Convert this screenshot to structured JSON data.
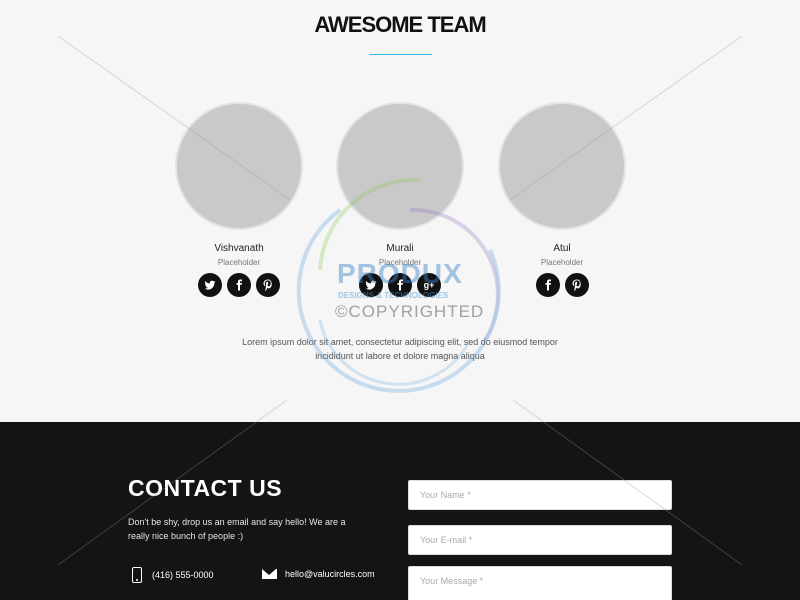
{
  "team": {
    "title": "AWESOME TEAM",
    "accent_color": "#35b8e8",
    "members": [
      {
        "name": "Vishvanath",
        "role": "Placeholder",
        "socials": [
          "twitter-icon",
          "facebook-icon",
          "pinterest-icon"
        ]
      },
      {
        "name": "Murali",
        "role": "Placeholder",
        "socials": [
          "twitter-icon",
          "facebook-icon",
          "google-plus-icon"
        ]
      },
      {
        "name": "Atul",
        "role": "Placeholder",
        "socials": [
          "facebook-icon",
          "pinterest-icon"
        ]
      }
    ],
    "description": "Lorem ipsum dolor sit amet, consectetur adipiscing elit, sed do eiusmod tempor incididunt ut labore et dolore magna aliqua",
    "google_plus_glyph": "g+"
  },
  "watermark": {
    "brand": "PRODUX",
    "tagline": "DESIGNS & TECHNOLOGIES",
    "notice": "©COPYRIGHTED"
  },
  "contact": {
    "title": "CONTACT US",
    "text": "Don't be shy, drop us an email and say hello! We are a really nice bunch of people :)",
    "phone": "(416) 555-0000",
    "email": "hello@valucircles.com",
    "background_color": "#141414",
    "form": {
      "name_placeholder": "Your Name *",
      "email_placeholder": "Your E-mail *",
      "message_placeholder": "Your Message *"
    }
  }
}
